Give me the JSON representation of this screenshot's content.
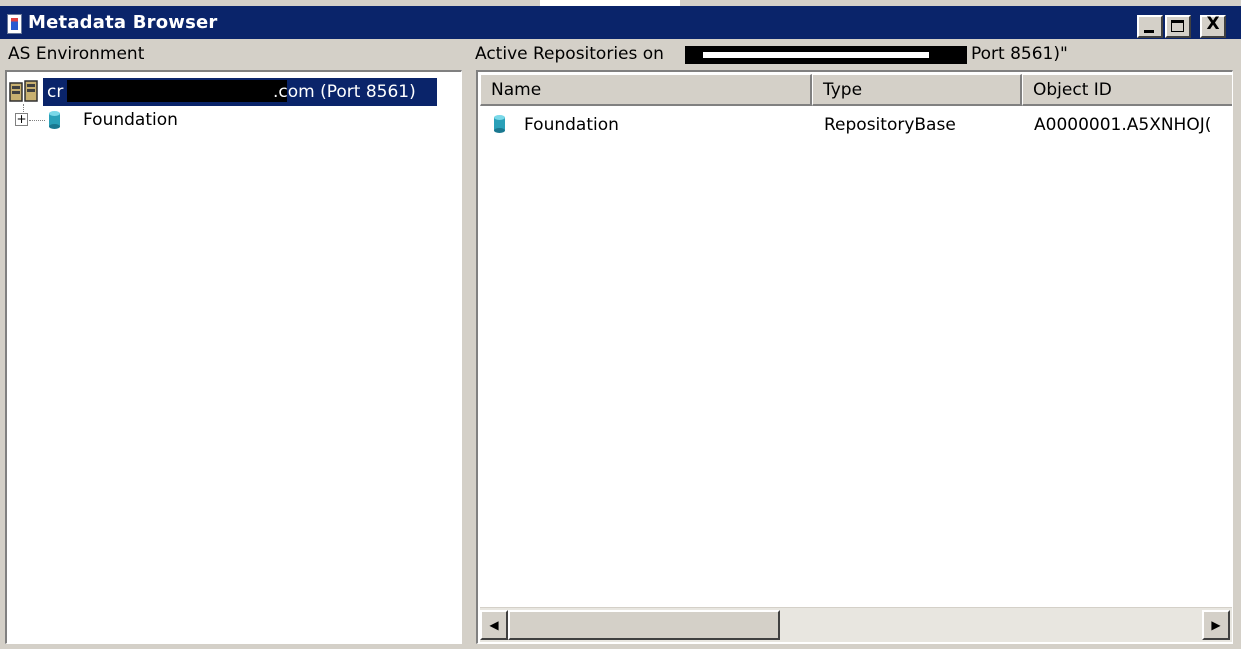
{
  "window": {
    "title": "Metadata Browser",
    "controls": [
      "minimize",
      "maximize",
      "close"
    ],
    "close_glyph": "X",
    "colors": {
      "titlebar": "#0a246a",
      "selection": "#0a246a",
      "face": "#d4d0c8"
    }
  },
  "left_pane": {
    "header": "AS Environment",
    "tree": {
      "root": {
        "label_prefix": "cr",
        "label_suffix": ".com (Port 8561)",
        "icon": "server-icon",
        "selected": true
      },
      "children": [
        {
          "label": "Foundation",
          "icon": "repository-icon",
          "expander": "+"
        }
      ]
    }
  },
  "right_pane": {
    "header_prefix": "Active Repositories on",
    "header_suffix": "Port 8561)\"",
    "columns": [
      "Name",
      "Type",
      "Object ID"
    ],
    "rows": [
      {
        "name": "Foundation",
        "type": "RepositoryBase",
        "object_id": "A0000001.A5XNHOJ(",
        "icon": "repository-icon"
      }
    ],
    "scrollbar": {
      "left_arrow": "◀",
      "right_arrow": "▶"
    }
  }
}
